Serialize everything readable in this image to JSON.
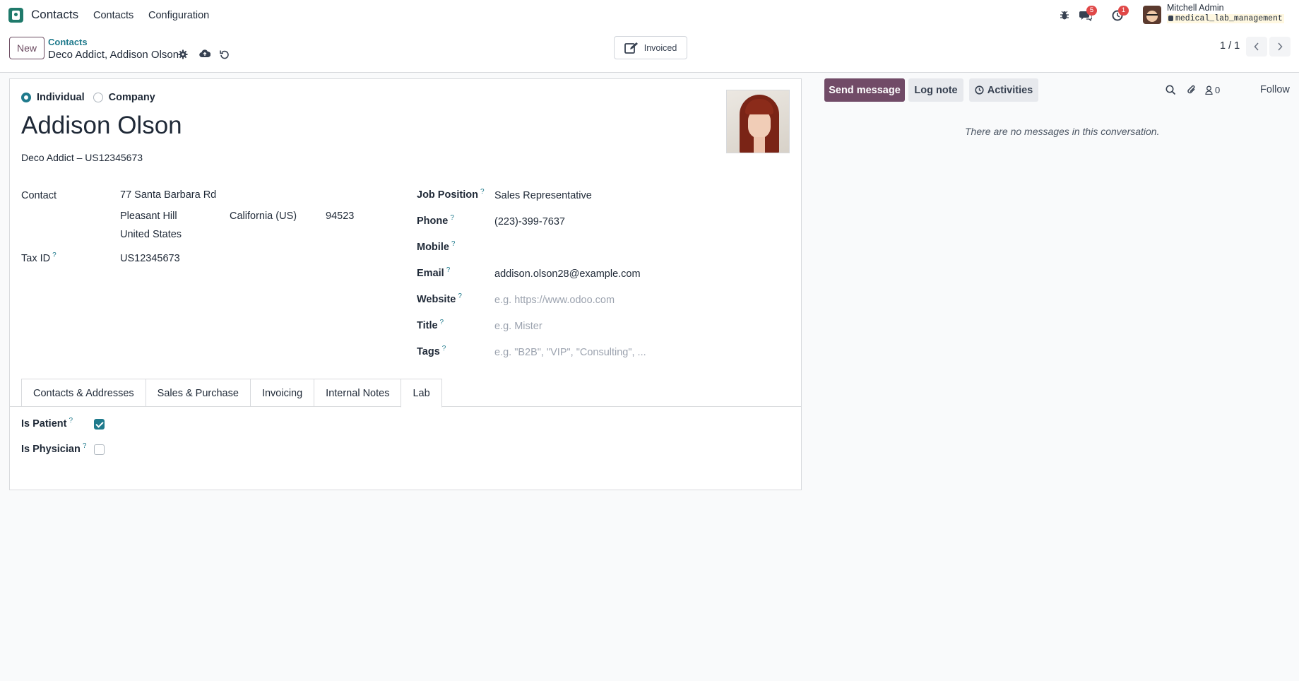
{
  "navbar": {
    "app_name": "Contacts",
    "menu": [
      "Contacts",
      "Configuration"
    ],
    "messages_count": "5",
    "activities_count": "1",
    "user_name": "Mitchell Admin",
    "database": "medical_lab_management"
  },
  "control": {
    "new_label": "New",
    "breadcrumb_parent": "Contacts",
    "breadcrumb_current": "Deco Addict, Addison Olson",
    "invoiced_label": "Invoiced",
    "pager": "1 / 1"
  },
  "form": {
    "type_options": [
      "Individual",
      "Company"
    ],
    "selected_type": "Individual",
    "name": "Addison Olson",
    "company_line": "Deco Addict – US12345673",
    "left": {
      "contact_label": "Contact",
      "street": "77 Santa Barbara Rd",
      "city": "Pleasant Hill",
      "state": "California (US)",
      "zip": "94523",
      "country": "United States",
      "tax_id_label": "Tax ID",
      "tax_id": "US12345673"
    },
    "right": {
      "job_position_label": "Job Position",
      "job_position": "Sales Representative",
      "phone_label": "Phone",
      "phone": "(223)-399-7637",
      "mobile_label": "Mobile",
      "mobile": "",
      "email_label": "Email",
      "email": "addison.olson28@example.com",
      "website_label": "Website",
      "website_placeholder": "e.g. https://www.odoo.com",
      "title_label": "Title",
      "title_placeholder": "e.g. Mister",
      "tags_label": "Tags",
      "tags_placeholder": "e.g. \"B2B\", \"VIP\", \"Consulting\", ..."
    },
    "tabs": [
      "Contacts & Addresses",
      "Sales & Purchase",
      "Invoicing",
      "Internal Notes",
      "Lab"
    ],
    "active_tab": "Lab",
    "lab": {
      "is_patient_label": "Is Patient",
      "is_patient": true,
      "is_physician_label": "Is Physician",
      "is_physician": false
    }
  },
  "chatter": {
    "send_message": "Send message",
    "log_note": "Log note",
    "activities": "Activities",
    "followers_count": "0",
    "follow": "Follow",
    "empty_text": "There are no messages in this conversation."
  },
  "colors": {
    "primary": "#714b67",
    "accent": "#1f7a8c",
    "badge": "#e04848"
  }
}
